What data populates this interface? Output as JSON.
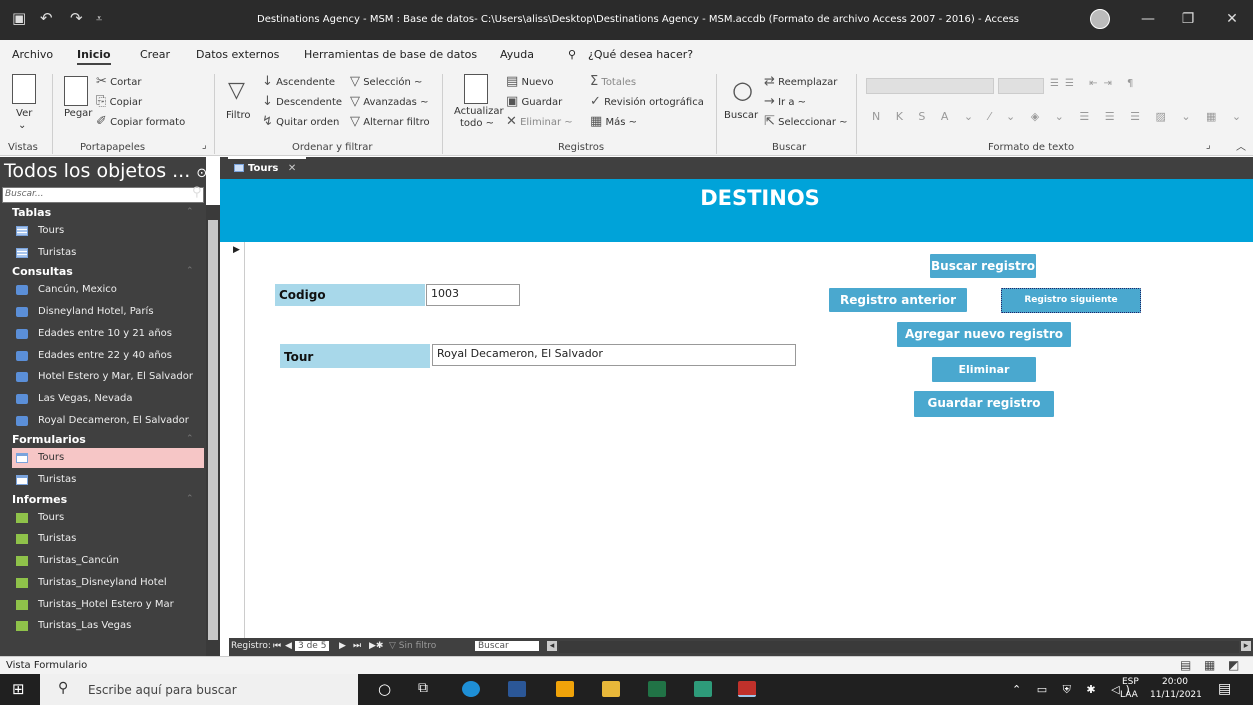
{
  "window": {
    "title": "Destinations Agency - MSM : Base de datos- C:\\Users\\aliss\\Desktop\\Destinations Agency - MSM.accdb (Formato de archivo Access 2007 - 2016)  -  Access"
  },
  "menu": {
    "items": [
      "Archivo",
      "Inicio",
      "Crear",
      "Datos externos",
      "Herramientas de base de datos",
      "Ayuda"
    ],
    "search": "¿Qué desea hacer?"
  },
  "ribbon": {
    "vistas": {
      "ver": "Ver",
      "group": "Vistas"
    },
    "portapapeles": {
      "pegar": "Pegar",
      "cortar": "Cortar",
      "copiar": "Copiar",
      "copiar_formato": "Copiar formato",
      "group": "Portapapeles"
    },
    "ordenar": {
      "filtro": "Filtro",
      "ascendente": "Ascendente",
      "descendente": "Descendente",
      "quitar_orden": "Quitar orden",
      "seleccion": "Selección ~",
      "avanzadas": "Avanzadas ~",
      "alternar_filtro": "Alternar filtro",
      "group": "Ordenar y filtrar"
    },
    "registros": {
      "actualizar": "Actualizar",
      "todo": "todo ~",
      "nuevo": "Nuevo",
      "guardar": "Guardar",
      "eliminar": "Eliminar ~",
      "totales": "Totales",
      "revision": "Revisión ortográfica",
      "mas": "Más ~",
      "group": "Registros"
    },
    "buscar": {
      "buscar": "Buscar",
      "reemplazar": "Reemplazar",
      "ir_a": "Ir a ~",
      "seleccionar": "Seleccionar ~",
      "group": "Buscar"
    },
    "formato": {
      "group": "Formato de texto"
    }
  },
  "nav": {
    "header": "Todos los objetos ...",
    "search_placeholder": "Buscar...",
    "categories": [
      {
        "name": "Tablas",
        "items": [
          "Tours",
          "Turistas"
        ]
      },
      {
        "name": "Consultas",
        "items": [
          "Cancún, Mexico",
          "Disneyland Hotel, París",
          "Edades entre 10 y 21 años",
          "Edades entre 22 y 40 años",
          "Hotel Estero y Mar, El Salvador",
          "Las Vegas, Nevada",
          "Royal Decameron, El Salvador"
        ]
      },
      {
        "name": "Formularios",
        "items": [
          "Tours",
          "Turistas"
        ]
      },
      {
        "name": "Informes",
        "items": [
          "Tours",
          "Turistas",
          "Turistas_Cancún",
          "Turistas_Disneyland Hotel",
          "Turistas_Hotel Estero y Mar",
          "Turistas_Las Vegas"
        ]
      }
    ]
  },
  "doc": {
    "tab": "Tours",
    "form_title": "DESTINOS",
    "fields": {
      "codigo_label": "Codigo",
      "codigo_value": "1003",
      "tour_label": "Tour",
      "tour_value": "Royal Decameron, El Salvador"
    },
    "buttons": {
      "buscar": "Buscar registro",
      "anterior": "Registro anterior",
      "siguiente": "Registro siguiente",
      "agregar": "Agregar nuevo registro",
      "eliminar": "Eliminar",
      "guardar": "Guardar registro"
    }
  },
  "recnav": {
    "label": "Registro:",
    "position": "3 de 5",
    "filter": "Sin filtro",
    "search": "Buscar"
  },
  "status": {
    "text": "Vista Formulario"
  },
  "taskbar": {
    "search": "Escribe aquí para buscar",
    "lang": "ESP",
    "lang2": "LAA",
    "time": "20:00",
    "date": "11/11/2021"
  },
  "colors": {
    "header": "#00a3d9",
    "button": "#4aa8cf",
    "label": "#a8d8ea",
    "nav": "#404040"
  }
}
